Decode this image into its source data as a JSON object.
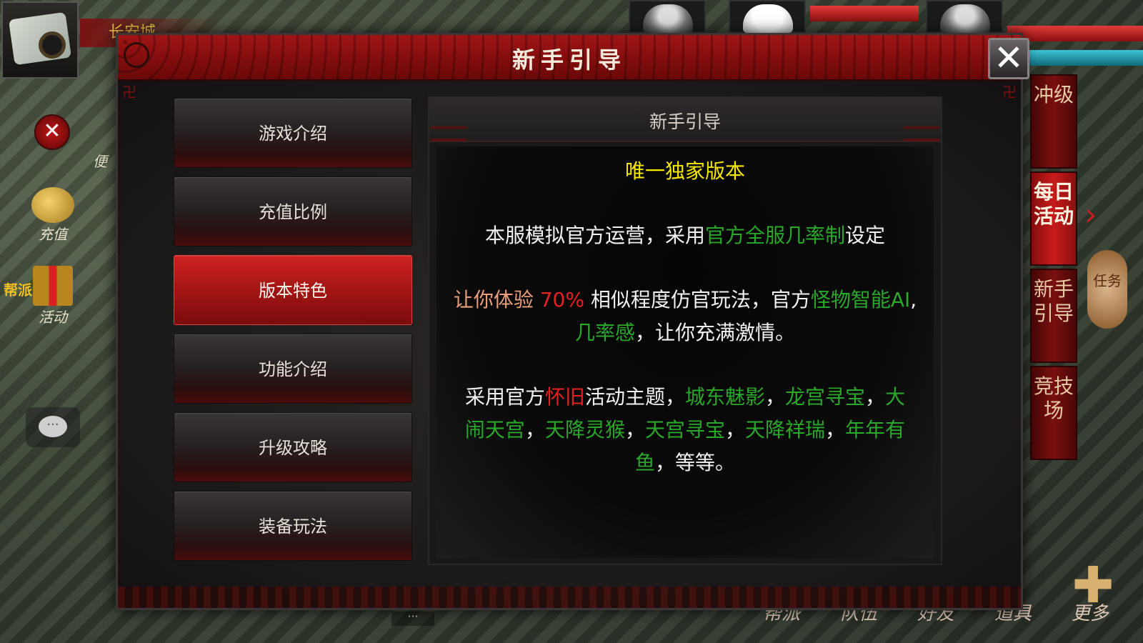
{
  "hud": {
    "city_name": "长安城",
    "left_label": "便",
    "recharge_label": "充值",
    "gang_label": "帮派",
    "activity_label": "活动",
    "chat_glyph": "···",
    "more_dots": "···",
    "lantern_label": "任务",
    "right_tabs": [
      "冲级",
      "每日活动",
      "新手引导",
      "竞技场"
    ],
    "bottom_bar": [
      "帮派",
      "队伍",
      "好友",
      "道具",
      "更多"
    ]
  },
  "dialog": {
    "title": "新手引导",
    "close_glyph": "✕",
    "menu": [
      {
        "label": "游戏介绍",
        "active": false
      },
      {
        "label": "充值比例",
        "active": false
      },
      {
        "label": "版本特色",
        "active": true
      },
      {
        "label": "功能介绍",
        "active": false
      },
      {
        "label": "升级攻略",
        "active": false
      },
      {
        "label": "装备玩法",
        "active": false
      }
    ],
    "panel": {
      "title": "新手引导",
      "headline": "唯一独家版本",
      "p1": {
        "a": "本服模拟官方运营，采用",
        "b": "官方全服几率制",
        "c": "设定"
      },
      "p2": {
        "a": "让你体验 ",
        "b": "70%",
        "c": " 相似程度仿官玩法，官方",
        "d": "怪物智能AI",
        "e": ",",
        "f": "几率感",
        "g": "，让你充满激情。"
      },
      "p3": {
        "a": "采用官方",
        "b": "怀旧",
        "c": "活动主题，",
        "d": "城东魅影",
        "e": "，",
        "f": "龙宫寻宝",
        "g": "，",
        "h": "大闹天宫",
        "i": "，",
        "j": "天降灵猴",
        "k": "，",
        "l": "天宫寻宝",
        "m": "，",
        "n": "天降祥瑞",
        "o": "，",
        "p": "年年有鱼",
        "q": "，等等。"
      }
    }
  },
  "colors": {
    "accent_red": "#a01414",
    "highlight_green": "#2aa82a",
    "highlight_red": "#e82020",
    "headline_yellow": "#f6e800"
  }
}
